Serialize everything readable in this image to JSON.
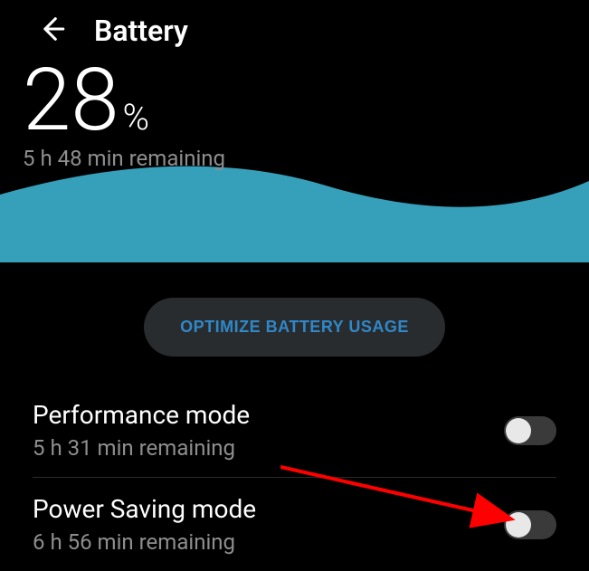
{
  "header": {
    "title": "Battery"
  },
  "battery": {
    "percent_value": "28",
    "percent_sign": "%",
    "remaining": "5 h 48 min remaining"
  },
  "optimize": {
    "label": "OPTIMIZE BATTERY USAGE"
  },
  "modes": [
    {
      "title": "Performance mode",
      "remaining": "5 h 31 min remaining",
      "enabled": false
    },
    {
      "title": "Power Saving mode",
      "remaining": "6 h 56 min remaining",
      "enabled": false
    }
  ],
  "colors": {
    "wave": "#36a0bb",
    "accent": "#2f88c9",
    "annotation": "#ff0000"
  }
}
